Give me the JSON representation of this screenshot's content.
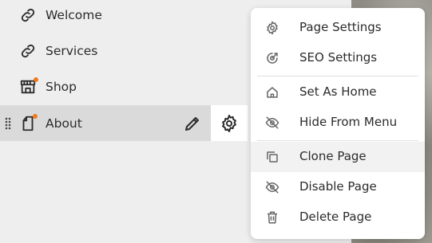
{
  "sidebar": {
    "items": [
      {
        "label": "Welcome",
        "icon": "link-icon"
      },
      {
        "label": "Services",
        "icon": "link-icon"
      },
      {
        "label": "Shop",
        "icon": "store-icon"
      },
      {
        "label": "About",
        "icon": "page-icon",
        "active": true
      }
    ]
  },
  "menu": {
    "items": [
      {
        "label": "Page Settings",
        "icon": "gear-icon"
      },
      {
        "label": "SEO Settings",
        "icon": "seo-target-icon"
      },
      {
        "label": "Set As Home",
        "icon": "home-icon"
      },
      {
        "label": "Hide From Menu",
        "icon": "eye-off-icon"
      },
      {
        "label": "Clone Page",
        "icon": "copy-icon"
      },
      {
        "label": "Disable Page",
        "icon": "eye-off-icon"
      },
      {
        "label": "Delete Page",
        "icon": "trash-icon"
      }
    ]
  },
  "colors": {
    "accent_badge": "#f07b1f",
    "active_row": "#dadada",
    "menu_hover": "#f2f2f2"
  }
}
